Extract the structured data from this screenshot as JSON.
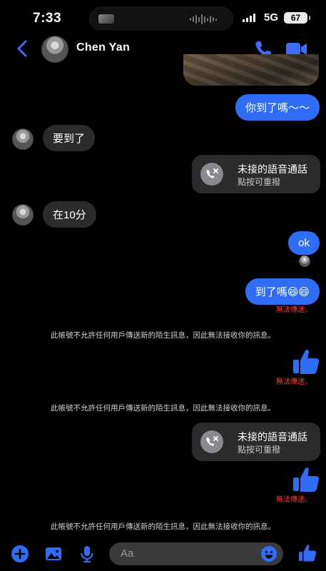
{
  "status_bar": {
    "time": "7:33",
    "network": "5G",
    "battery": "67"
  },
  "header": {
    "contact_name": "Chen Yan"
  },
  "messages": {
    "m1_out": "你到了嗎～～",
    "m2_in": "要到了",
    "m3_call": {
      "title": "未接的語音通話",
      "subtitle": "點按可重撥"
    },
    "m4_in": "在10分",
    "m5_out": "ok",
    "m6_out": "到了嗎😄😄",
    "m6_status": "無法傳送。",
    "notice_1": "此帳號不允許任何用戶傳送新的陌生訊息，因此無法接收你的訊息。",
    "m7_status": "無法傳送。",
    "notice_2": "此帳號不允許任何用戶傳送新的陌生訊息，因此無法接收你的訊息。",
    "m8_call": {
      "title": "未接的語音通話",
      "subtitle": "點按可重撥"
    },
    "m9_status": "無法傳送。",
    "notice_3": "此帳號不允許任何用戶傳送新的陌生訊息，因此無法接收你的訊息。"
  },
  "composer": {
    "placeholder": "Aa"
  },
  "colors": {
    "accent": "#2f6df6",
    "error": "#ff3b30",
    "incoming_bubble": "#2b2b2d"
  },
  "icons": [
    "back-chevron-icon",
    "phone-icon",
    "video-camera-icon",
    "missed-call-icon",
    "thumbs-up-icon",
    "plus-icon",
    "image-icon",
    "microphone-icon",
    "emoji-icon"
  ]
}
